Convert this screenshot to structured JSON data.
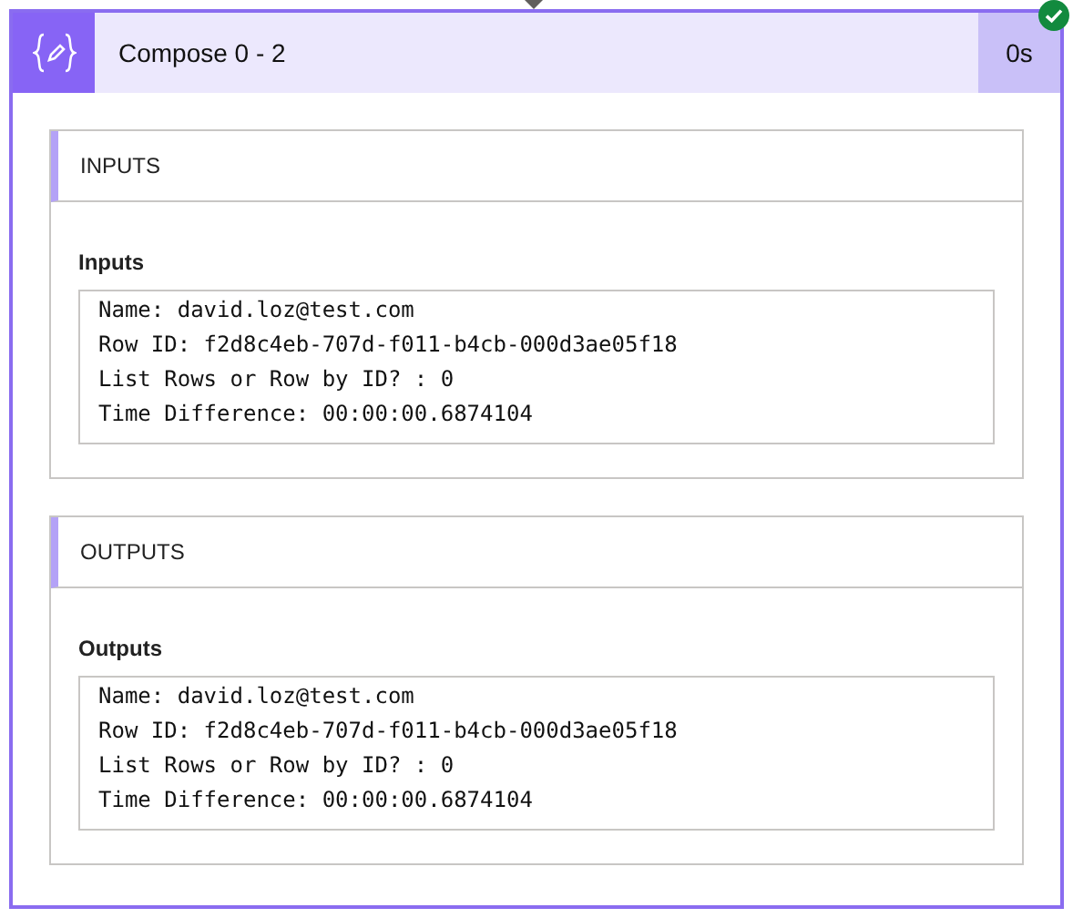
{
  "action": {
    "title": "Compose 0 - 2",
    "duration": "0s"
  },
  "sections": [
    {
      "heading": "INPUTS",
      "label": "Inputs",
      "lines": [
        "Name: david.loz@test.com",
        "Row ID: f2d8c4eb-707d-f011-b4cb-000d3ae05f18",
        "List Rows or Row by ID? : 0",
        "Time Difference: 00:00:00.6874104"
      ]
    },
    {
      "heading": "OUTPUTS",
      "label": "Outputs",
      "lines": [
        "Name: david.loz@test.com",
        "Row ID: f2d8c4eb-707d-f011-b4cb-000d3ae05f18",
        "List Rows or Row by ID? : 0",
        "Time Difference: 00:00:00.6874104"
      ]
    }
  ]
}
